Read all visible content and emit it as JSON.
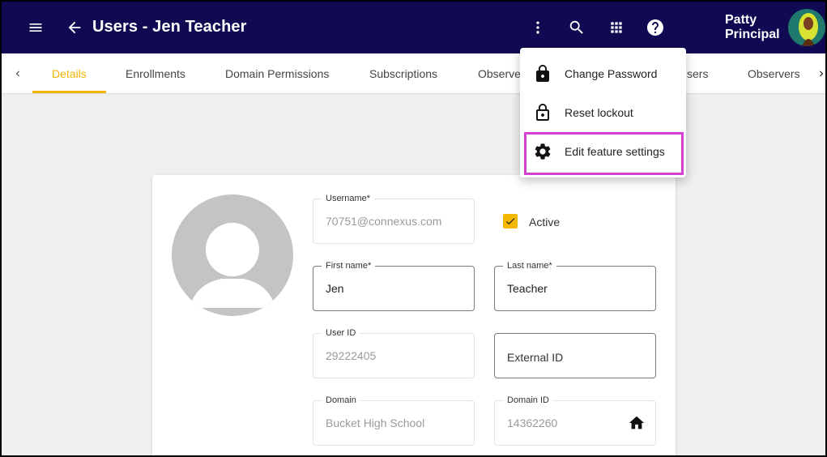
{
  "header": {
    "title": "Users - Jen Teacher",
    "user_name_line1": "Patty",
    "user_name_line2": "Principal",
    "icons": [
      "menu-icon",
      "back-arrow-icon",
      "more-vert-icon",
      "search-icon",
      "apps-grid-icon",
      "help-icon"
    ]
  },
  "tabs": [
    {
      "label": "Details",
      "active": true
    },
    {
      "label": "Enrollments"
    },
    {
      "label": "Domain Permissions"
    },
    {
      "label": "Subscriptions"
    },
    {
      "label": "Observe"
    },
    {
      "label": "sers"
    },
    {
      "label": "Observers"
    }
  ],
  "form": {
    "username": {
      "label": "Username*",
      "value": "70751@connexus.com"
    },
    "active": {
      "label": "Active",
      "checked": true
    },
    "first_name": {
      "label": "First name*",
      "value": "Jen"
    },
    "last_name": {
      "label": "Last name*",
      "value": "Teacher"
    },
    "user_id": {
      "label": "User ID",
      "value": "29222405"
    },
    "external_id": {
      "placeholder": "External ID"
    },
    "domain": {
      "label": "Domain",
      "value": "Bucket High School"
    },
    "domain_id": {
      "label": "Domain ID",
      "value": "14362260"
    }
  },
  "menu": {
    "items": [
      {
        "label": "Change Password",
        "icon": "lock-icon"
      },
      {
        "label": "Reset lockout",
        "icon": "lock-open-icon"
      },
      {
        "label": "Edit feature settings",
        "icon": "gear-icon",
        "highlighted": true
      }
    ]
  },
  "colors": {
    "appbar": "#0f0a52",
    "accent": "#f2b705",
    "highlight": "#d63fd3"
  }
}
